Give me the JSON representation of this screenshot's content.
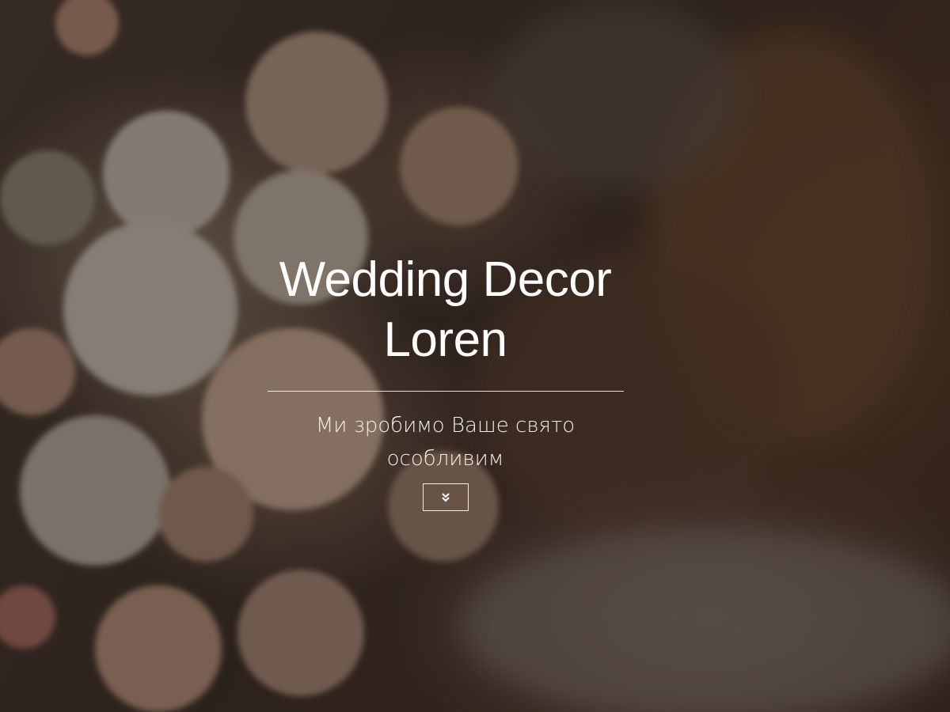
{
  "hero": {
    "title_line1": "Wedding Decor",
    "title_line2": "Loren",
    "subtitle_line1": "Ми зробимо Ваше свято",
    "subtitle_line2": "особливим",
    "scroll_icon": "double-chevron-down-icon"
  },
  "colors": {
    "text": "#ffffff",
    "overlay": "#140e0a",
    "background": "#3b2f28"
  }
}
